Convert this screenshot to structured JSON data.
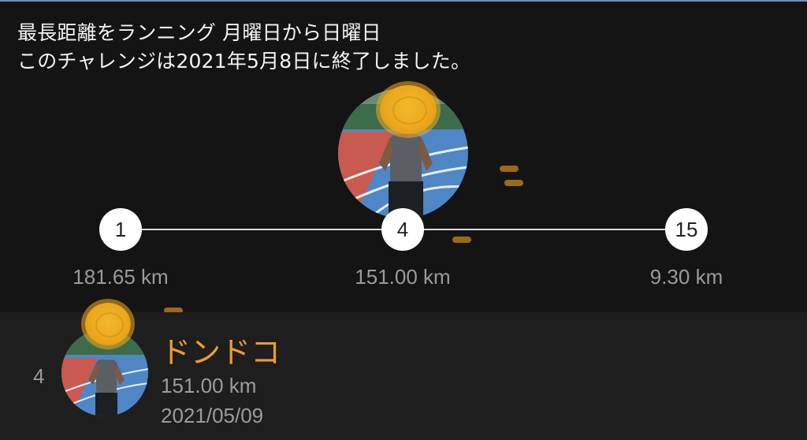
{
  "challenge": {
    "title": "最長距離をランニング 月曜日から日曜日",
    "status": "このチャレンジは2021年5月8日に終了しました。"
  },
  "ranking_track": {
    "nodes": [
      {
        "rank": "1",
        "distance": "181.65 km"
      },
      {
        "rank": "4",
        "distance": "151.00 km"
      },
      {
        "rank": "15",
        "distance": "9.30 km"
      }
    ]
  },
  "current_user": {
    "rank": "4",
    "name": "ドンドコ",
    "distance": "151.00 km",
    "date": "2021/05/09",
    "name_color": "#ee9a33"
  },
  "icons": {
    "avatar": "runner-photo",
    "face_cover": "orange-coin-sticker"
  }
}
